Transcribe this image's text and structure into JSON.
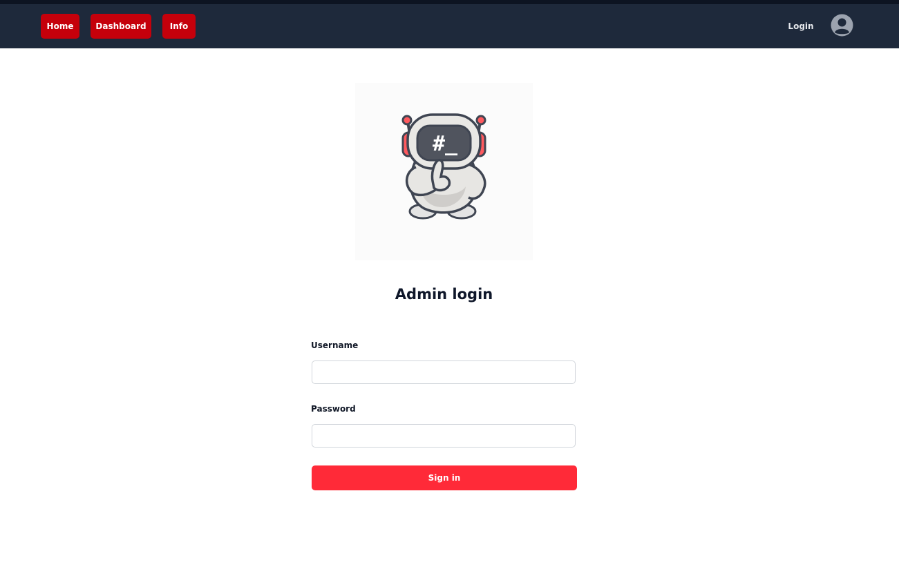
{
  "nav": {
    "items": [
      {
        "label": "Home"
      },
      {
        "label": "Dashboard"
      },
      {
        "label": "Info"
      }
    ],
    "login_label": "Login",
    "avatar_icon": "user-circle-icon"
  },
  "mascot": {
    "icon": "astronaut-robot-mascot",
    "screen_text": "#_"
  },
  "form": {
    "title": "Admin login",
    "username_label": "Username",
    "username_value": "",
    "password_label": "Password",
    "password_value": "",
    "submit_label": "Sign in"
  },
  "colors": {
    "nav_bg": "#1e293b",
    "nav_button": "#c5000b",
    "primary_button": "#ff2a38",
    "text_dark": "#0f172a"
  }
}
